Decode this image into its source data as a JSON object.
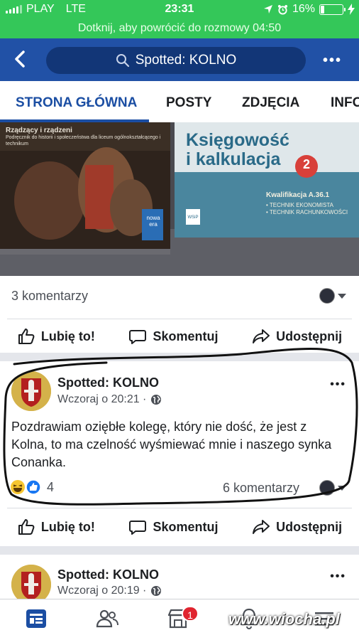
{
  "status_bar": {
    "carrier": "PLAY",
    "network": "LTE",
    "time": "23:31",
    "battery": "16%",
    "battery_level": 0.16
  },
  "call_banner": "Dotknij, aby powrócić do rozmowy 04:50",
  "nav": {
    "search_text": "Spotted: KOLNO"
  },
  "tabs": [
    {
      "label": "STRONA GŁÓWNA",
      "active": true
    },
    {
      "label": "POSTY"
    },
    {
      "label": "ZDJĘCIA"
    },
    {
      "label": "INFO"
    }
  ],
  "photo": {
    "book1_title": "Rządzący i rządzeni",
    "book1_subtitle": "Podręcznik do historii i społeczeństwa dla liceum ogólnokształcącego i technikum",
    "book1_brand": "nowa era",
    "book2_title_line1": "Księgowość",
    "book2_title_line2": "i kalkulacja",
    "book2_number": "2",
    "book2_qualification": "Kwalifikacja A.36.1",
    "book2_list1": "• TECHNIK EKONOMISTA",
    "book2_list2": "• TECHNIK RACHUNKOWOŚCI",
    "book2_brand": "WSiP"
  },
  "post1": {
    "comments": "3 komentarzy"
  },
  "actions": {
    "like": "Lubię to!",
    "comment": "Skomentuj",
    "share": "Udostępnij"
  },
  "post2": {
    "author": "Spotted: KOLNO",
    "time": "Wczoraj o 20:21 ·",
    "text": "Pozdrawiam oziębłe kolegę, który nie dość, że jest z Kolna, to ma czelność wyśmiewać mnie i naszego synka Conanka.",
    "reactions_count": "4",
    "comments": "6 komentarzy"
  },
  "post3": {
    "author": "Spotted: KOLNO",
    "time": "Wczoraj o 20:19 ·"
  },
  "bottom_bar": {
    "marketplace_badge": "1"
  },
  "watermark": "www.wiocha.pl",
  "colors": {
    "status_green": "#34c759",
    "nav_blue": "#2151a6",
    "accent_blue": "#1b4ea3",
    "badge_red": "#e0242f"
  }
}
